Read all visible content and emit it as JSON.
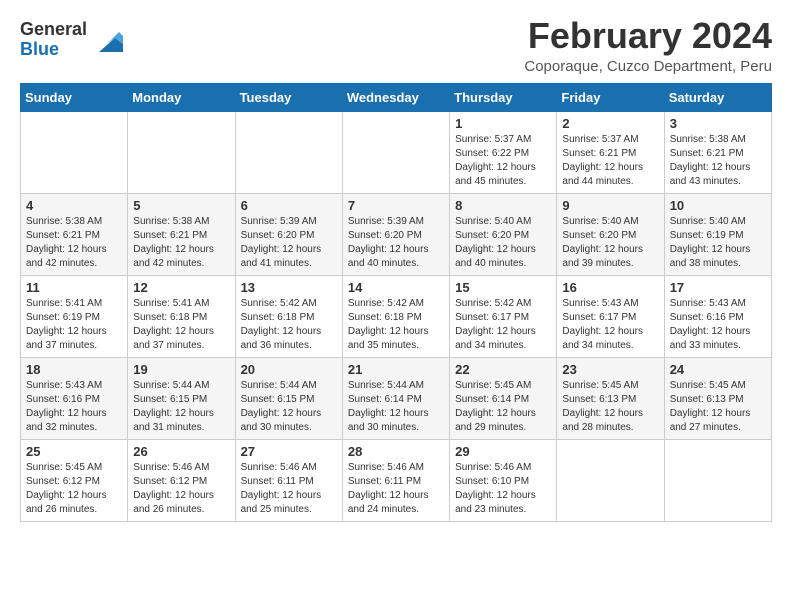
{
  "logo": {
    "general": "General",
    "blue": "Blue"
  },
  "header": {
    "month": "February 2024",
    "location": "Coporaque, Cuzco Department, Peru"
  },
  "days_of_week": [
    "Sunday",
    "Monday",
    "Tuesday",
    "Wednesday",
    "Thursday",
    "Friday",
    "Saturday"
  ],
  "weeks": [
    [
      {
        "day": "",
        "info": ""
      },
      {
        "day": "",
        "info": ""
      },
      {
        "day": "",
        "info": ""
      },
      {
        "day": "",
        "info": ""
      },
      {
        "day": "1",
        "info": "Sunrise: 5:37 AM\nSunset: 6:22 PM\nDaylight: 12 hours\nand 45 minutes."
      },
      {
        "day": "2",
        "info": "Sunrise: 5:37 AM\nSunset: 6:21 PM\nDaylight: 12 hours\nand 44 minutes."
      },
      {
        "day": "3",
        "info": "Sunrise: 5:38 AM\nSunset: 6:21 PM\nDaylight: 12 hours\nand 43 minutes."
      }
    ],
    [
      {
        "day": "4",
        "info": "Sunrise: 5:38 AM\nSunset: 6:21 PM\nDaylight: 12 hours\nand 42 minutes."
      },
      {
        "day": "5",
        "info": "Sunrise: 5:38 AM\nSunset: 6:21 PM\nDaylight: 12 hours\nand 42 minutes."
      },
      {
        "day": "6",
        "info": "Sunrise: 5:39 AM\nSunset: 6:20 PM\nDaylight: 12 hours\nand 41 minutes."
      },
      {
        "day": "7",
        "info": "Sunrise: 5:39 AM\nSunset: 6:20 PM\nDaylight: 12 hours\nand 40 minutes."
      },
      {
        "day": "8",
        "info": "Sunrise: 5:40 AM\nSunset: 6:20 PM\nDaylight: 12 hours\nand 40 minutes."
      },
      {
        "day": "9",
        "info": "Sunrise: 5:40 AM\nSunset: 6:20 PM\nDaylight: 12 hours\nand 39 minutes."
      },
      {
        "day": "10",
        "info": "Sunrise: 5:40 AM\nSunset: 6:19 PM\nDaylight: 12 hours\nand 38 minutes."
      }
    ],
    [
      {
        "day": "11",
        "info": "Sunrise: 5:41 AM\nSunset: 6:19 PM\nDaylight: 12 hours\nand 37 minutes."
      },
      {
        "day": "12",
        "info": "Sunrise: 5:41 AM\nSunset: 6:18 PM\nDaylight: 12 hours\nand 37 minutes."
      },
      {
        "day": "13",
        "info": "Sunrise: 5:42 AM\nSunset: 6:18 PM\nDaylight: 12 hours\nand 36 minutes."
      },
      {
        "day": "14",
        "info": "Sunrise: 5:42 AM\nSunset: 6:18 PM\nDaylight: 12 hours\nand 35 minutes."
      },
      {
        "day": "15",
        "info": "Sunrise: 5:42 AM\nSunset: 6:17 PM\nDaylight: 12 hours\nand 34 minutes."
      },
      {
        "day": "16",
        "info": "Sunrise: 5:43 AM\nSunset: 6:17 PM\nDaylight: 12 hours\nand 34 minutes."
      },
      {
        "day": "17",
        "info": "Sunrise: 5:43 AM\nSunset: 6:16 PM\nDaylight: 12 hours\nand 33 minutes."
      }
    ],
    [
      {
        "day": "18",
        "info": "Sunrise: 5:43 AM\nSunset: 6:16 PM\nDaylight: 12 hours\nand 32 minutes."
      },
      {
        "day": "19",
        "info": "Sunrise: 5:44 AM\nSunset: 6:15 PM\nDaylight: 12 hours\nand 31 minutes."
      },
      {
        "day": "20",
        "info": "Sunrise: 5:44 AM\nSunset: 6:15 PM\nDaylight: 12 hours\nand 30 minutes."
      },
      {
        "day": "21",
        "info": "Sunrise: 5:44 AM\nSunset: 6:14 PM\nDaylight: 12 hours\nand 30 minutes."
      },
      {
        "day": "22",
        "info": "Sunrise: 5:45 AM\nSunset: 6:14 PM\nDaylight: 12 hours\nand 29 minutes."
      },
      {
        "day": "23",
        "info": "Sunrise: 5:45 AM\nSunset: 6:13 PM\nDaylight: 12 hours\nand 28 minutes."
      },
      {
        "day": "24",
        "info": "Sunrise: 5:45 AM\nSunset: 6:13 PM\nDaylight: 12 hours\nand 27 minutes."
      }
    ],
    [
      {
        "day": "25",
        "info": "Sunrise: 5:45 AM\nSunset: 6:12 PM\nDaylight: 12 hours\nand 26 minutes."
      },
      {
        "day": "26",
        "info": "Sunrise: 5:46 AM\nSunset: 6:12 PM\nDaylight: 12 hours\nand 26 minutes."
      },
      {
        "day": "27",
        "info": "Sunrise: 5:46 AM\nSunset: 6:11 PM\nDaylight: 12 hours\nand 25 minutes."
      },
      {
        "day": "28",
        "info": "Sunrise: 5:46 AM\nSunset: 6:11 PM\nDaylight: 12 hours\nand 24 minutes."
      },
      {
        "day": "29",
        "info": "Sunrise: 5:46 AM\nSunset: 6:10 PM\nDaylight: 12 hours\nand 23 minutes."
      },
      {
        "day": "",
        "info": ""
      },
      {
        "day": "",
        "info": ""
      }
    ]
  ]
}
